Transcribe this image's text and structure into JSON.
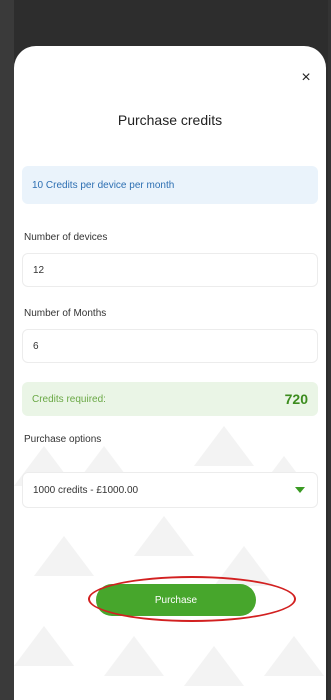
{
  "modal": {
    "title": "Purchase credits",
    "close_icon": "×",
    "info_banner": "10 Credits per device per month"
  },
  "fields": {
    "devices": {
      "label": "Number of devices",
      "value": "12"
    },
    "months": {
      "label": "Number of Months",
      "value": "6"
    }
  },
  "credits": {
    "label": "Credits required:",
    "value": "720"
  },
  "purchase_options": {
    "label": "Purchase options",
    "selected": "1000 credits - £1000.00"
  },
  "actions": {
    "purchase_label": "Purchase"
  },
  "colors": {
    "accent_green": "#47a62c",
    "info_blue_bg": "#eaf3fb",
    "credits_green_bg": "#eaf5e6",
    "annotation_red": "#d22020"
  }
}
